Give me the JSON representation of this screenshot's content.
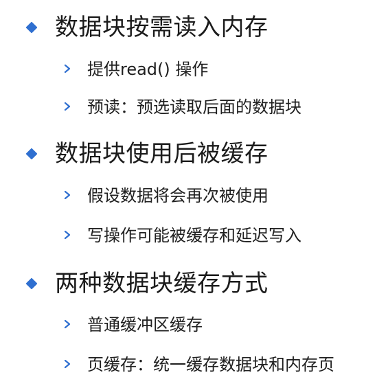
{
  "sections": [
    {
      "title": "数据块按需读入内存",
      "items": [
        "提供read() 操作",
        "预读：预选读取后面的数据块"
      ]
    },
    {
      "title": "数据块使用后被缓存",
      "items": [
        "假设数据将会再次被使用",
        "写操作可能被缓存和延迟写入"
      ]
    },
    {
      "title": "两种数据块缓存方式",
      "items": [
        "普通缓冲区缓存",
        "页缓存：统一缓存数据块和内存页"
      ]
    }
  ],
  "colors": {
    "bullet": "#2f6fd0",
    "text": "#1f1f1f"
  },
  "icons": {
    "level1": "diamond-icon",
    "level2": "chevron-right-icon"
  }
}
